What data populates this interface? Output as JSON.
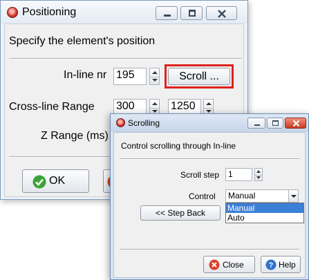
{
  "positioning": {
    "title": "Positioning",
    "heading": "Specify the element's position",
    "inline_label": "In-line nr",
    "inline_value": "195",
    "scroll_label": "Scroll ...",
    "crossline_label": "Cross-line Range",
    "crossline_from": "300",
    "crossline_to": "1250",
    "z_label": "Z Range (ms)",
    "ok_label": "OK"
  },
  "scrolling": {
    "title": "Scrolling",
    "heading": "Control scrolling through In-line",
    "step_label": "Scroll step",
    "step_value": "1",
    "control_label": "Control",
    "control_value": "Manual",
    "control_options": [
      "Manual",
      "Auto"
    ],
    "step_back_label": "<< Step Back",
    "close_label": "Close",
    "help_label": "Help"
  },
  "colors": {
    "highlight": "#e0201b",
    "selected_option": "#3c7fd6",
    "ok_icon": "#3aa335",
    "help_icon": "#2f6fd0",
    "close_icon": "#d8412a"
  },
  "icons": {
    "app": "app-icon",
    "ok": "checkmark-icon",
    "close": "close-x-icon",
    "help": "question-mark-icon",
    "minimize": "minimize-icon",
    "maximize": "maximize-icon",
    "window_close": "window-close-icon"
  }
}
